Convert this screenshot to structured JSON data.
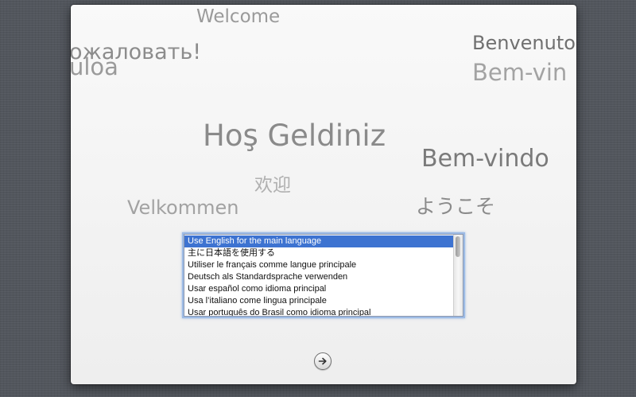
{
  "window": {
    "greetings": [
      {
        "text": "Welcome"
      },
      {
        "text": "ожаловать!"
      },
      {
        "text": "uloa"
      },
      {
        "text": "Benvenuto"
      },
      {
        "text": "Bem-vin"
      },
      {
        "text": "Hoş Geldiniz"
      },
      {
        "text": "Bem-vindo"
      },
      {
        "text": "欢迎"
      },
      {
        "text": "Velkommen"
      },
      {
        "text": "ようこそ"
      }
    ],
    "language_list": {
      "items": [
        "Use English for the main language",
        "主に日本語を使用する",
        "Utiliser le français comme langue principale",
        "Deutsch als Standardsprache verwenden",
        "Usar español como idioma principal",
        "Usa l’italiano come lingua principale",
        "Usar português do Brasil como idioma principal"
      ],
      "selected_index": 0
    },
    "continue_button": {
      "icon": "right-arrow-icon"
    }
  },
  "colors": {
    "desktop": "#52565d",
    "selection": "#3d73d1",
    "greeting_text": "#8a8a8a",
    "greeting_dark": "#777777"
  }
}
